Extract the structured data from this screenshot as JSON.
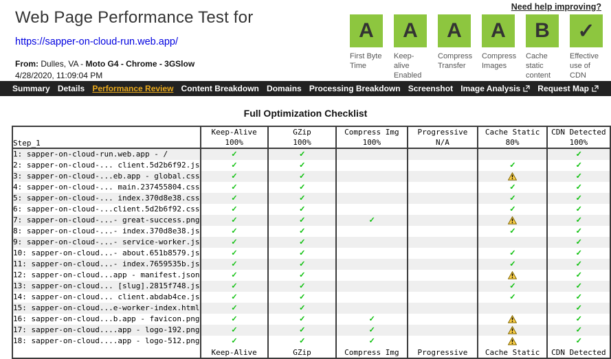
{
  "header": {
    "title": "Web Page Performance Test for",
    "url": "https://sapper-on-cloud-run.web.app/",
    "from_label": "From:",
    "location": "Dulles, VA -",
    "config": "Moto G4 - Chrome - 3GSlow",
    "date": "4/28/2020, 11:09:04 PM",
    "need_help": "Need help improving?"
  },
  "grades": [
    {
      "letter": "A",
      "label": "First Byte Time"
    },
    {
      "letter": "A",
      "label": "Keep-alive Enabled"
    },
    {
      "letter": "A",
      "label": "Compress Transfer"
    },
    {
      "letter": "A",
      "label": "Compress Images"
    },
    {
      "letter": "B",
      "label": "Cache static content"
    },
    {
      "letter": "✓",
      "label": "Effective use of CDN"
    }
  ],
  "nav": {
    "items": [
      {
        "label": "Summary",
        "active": false,
        "external": false
      },
      {
        "label": "Details",
        "active": false,
        "external": false
      },
      {
        "label": "Performance Review",
        "active": true,
        "external": false
      },
      {
        "label": "Content Breakdown",
        "active": false,
        "external": false
      },
      {
        "label": "Domains",
        "active": false,
        "external": false
      },
      {
        "label": "Processing Breakdown",
        "active": false,
        "external": false
      },
      {
        "label": "Screenshot",
        "active": false,
        "external": false
      },
      {
        "label": "Image Analysis",
        "active": false,
        "external": true
      },
      {
        "label": "Request Map",
        "active": false,
        "external": true
      }
    ]
  },
  "checklist": {
    "title": "Full Optimization Checklist",
    "step_label": "Step_1",
    "columns": [
      {
        "name": "Keep-Alive",
        "score": "100%"
      },
      {
        "name": "GZip",
        "score": "100%"
      },
      {
        "name": "Compress Img",
        "score": "100%"
      },
      {
        "name": "Progressive",
        "score": "N/A"
      },
      {
        "name": "Cache Static",
        "score": "80%"
      },
      {
        "name": "CDN Detected",
        "score": "100%"
      }
    ],
    "rows": [
      {
        "label": "1: sapper-on-cloud-run.web.app - /",
        "cells": [
          "check",
          "check",
          "",
          "",
          "",
          "check"
        ]
      },
      {
        "label": "2: sapper-on-cloud-... client.5d2b6f92.js",
        "cells": [
          "check",
          "check",
          "",
          "",
          "check",
          "check"
        ]
      },
      {
        "label": "3: sapper-on-cloud-...eb.app - global.css",
        "cells": [
          "check",
          "check",
          "",
          "",
          "warn",
          "check"
        ]
      },
      {
        "label": "4: sapper-on-cloud-... main.237455804.css",
        "cells": [
          "check",
          "check",
          "",
          "",
          "check",
          "check"
        ]
      },
      {
        "label": "5: sapper-on-cloud-... index.370d8e38.css",
        "cells": [
          "check",
          "check",
          "",
          "",
          "check",
          "check"
        ]
      },
      {
        "label": "6: sapper-on-cloud-...client.5d2b6f92.css",
        "cells": [
          "check",
          "check",
          "",
          "",
          "check",
          "check"
        ]
      },
      {
        "label": "7: sapper-on-cloud-...- great-success.png",
        "cells": [
          "check",
          "check",
          "check",
          "",
          "warn",
          "check"
        ]
      },
      {
        "label": "8: sapper-on-cloud-...- index.370d8e38.js",
        "cells": [
          "check",
          "check",
          "",
          "",
          "check",
          "check"
        ]
      },
      {
        "label": "9: sapper-on-cloud-...- service-worker.js",
        "cells": [
          "check",
          "check",
          "",
          "",
          "",
          "check"
        ]
      },
      {
        "label": "10: sapper-on-cloud...- about.651b8579.js",
        "cells": [
          "check",
          "check",
          "",
          "",
          "check",
          "check"
        ]
      },
      {
        "label": "11: sapper-on-cloud...- index.7659535b.js",
        "cells": [
          "check",
          "check",
          "",
          "",
          "check",
          "check"
        ]
      },
      {
        "label": "12: sapper-on-cloud...app - manifest.json",
        "cells": [
          "check",
          "check",
          "",
          "",
          "warn",
          "check"
        ]
      },
      {
        "label": "13: sapper-on-cloud... [slug].2815f748.js",
        "cells": [
          "check",
          "check",
          "",
          "",
          "check",
          "check"
        ]
      },
      {
        "label": "14: sapper-on-cloud... client.abdab4ce.js",
        "cells": [
          "check",
          "check",
          "",
          "",
          "check",
          "check"
        ]
      },
      {
        "label": "15: sapper-on-cloud...e-worker-index.html",
        "cells": [
          "check",
          "check",
          "",
          "",
          "",
          "check"
        ]
      },
      {
        "label": "16: sapper-on-cloud...b.app - favicon.png",
        "cells": [
          "check",
          "check",
          "check",
          "",
          "warn",
          "check"
        ]
      },
      {
        "label": "17: sapper-on-cloud....app - logo-192.png",
        "cells": [
          "check",
          "check",
          "check",
          "",
          "warn",
          "check"
        ]
      },
      {
        "label": "18: sapper-on-cloud....app - logo-512.png",
        "cells": [
          "check",
          "check",
          "check",
          "",
          "warn",
          "check"
        ]
      }
    ],
    "footer_labels": [
      "Keep-Alive",
      "GZip",
      "Compress Img",
      "Progressive",
      "Cache Static",
      "CDN Detected"
    ]
  },
  "colors": {
    "grade_green": "#8dc63f",
    "nav_background": "#222222",
    "nav_active": "#e9a91c",
    "check_green": "#0cc00c",
    "warning_yellow": "#ffd24a",
    "link_blue": "#0000e0",
    "row_stripe": "#efefef"
  },
  "icons": {
    "check": "green-check-icon",
    "warn": "yellow-warning-icon",
    "external": "external-link-icon"
  }
}
